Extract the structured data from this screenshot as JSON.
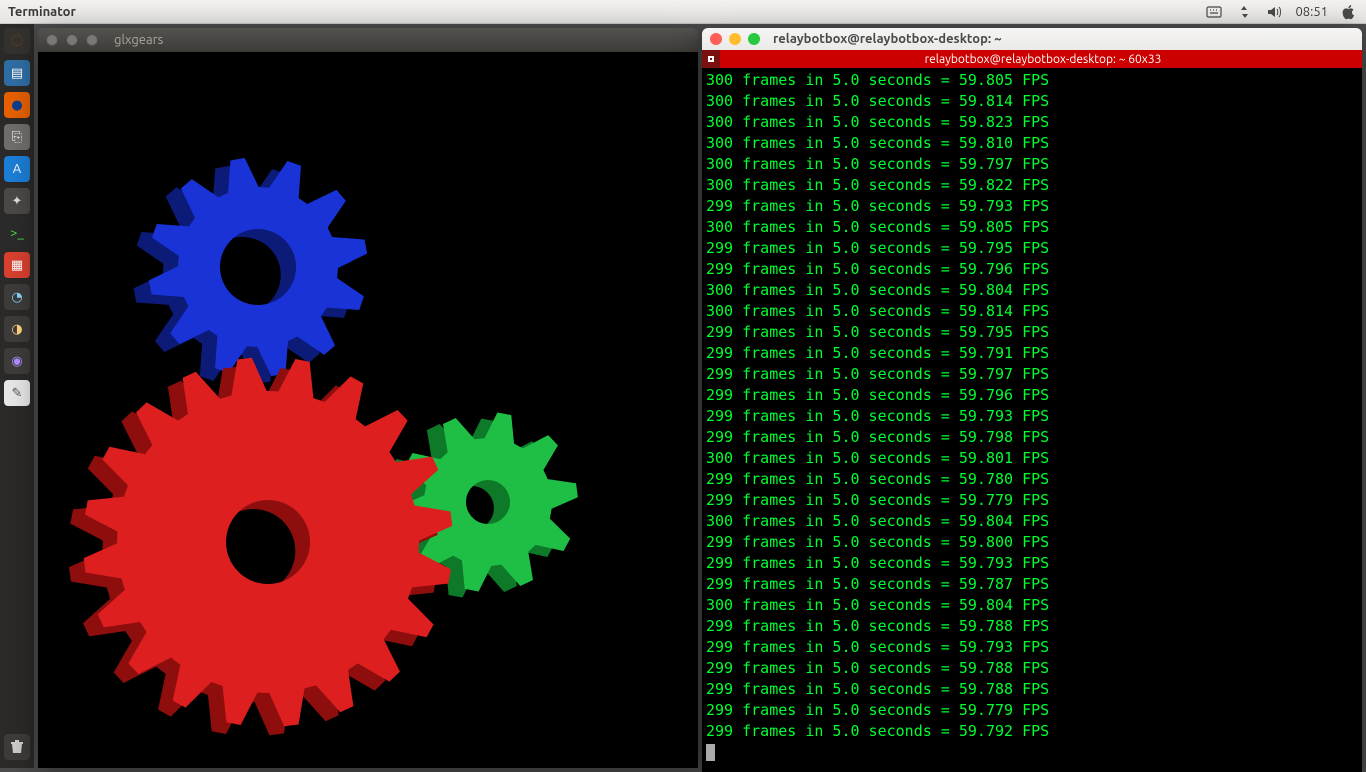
{
  "menubar": {
    "app_title": "Terminator",
    "clock": "08:51"
  },
  "launcher": {
    "items": [
      {
        "name": "dash",
        "bg": "#33322f",
        "glyph": "◌",
        "color": "#dd4814"
      },
      {
        "name": "files",
        "bg": "#2f6ea5",
        "glyph": "▤",
        "color": "#fff"
      },
      {
        "name": "firefox",
        "bg": "#e66000",
        "glyph": "●",
        "color": "#0b3e8c"
      },
      {
        "name": "software",
        "bg": "#6f6e6c",
        "glyph": "⎘",
        "color": "#fff"
      },
      {
        "name": "appstore",
        "bg": "#1c7ed6",
        "glyph": "A",
        "color": "#fff"
      },
      {
        "name": "settings",
        "bg": "#4a4947",
        "glyph": "✦",
        "color": "#ddd"
      },
      {
        "name": "terminal",
        "bg": "#2b2b2b",
        "glyph": ">_",
        "color": "#4ae24a"
      },
      {
        "name": "tile",
        "bg": "#d94030",
        "glyph": "▦",
        "color": "#fff"
      },
      {
        "name": "app1",
        "bg": "#3d3c3a",
        "glyph": "◔",
        "color": "#8fd3ff"
      },
      {
        "name": "app2",
        "bg": "#3d3c3a",
        "glyph": "◑",
        "color": "#ffd27f"
      },
      {
        "name": "app3",
        "bg": "#3d3c3a",
        "glyph": "◉",
        "color": "#b18cff"
      },
      {
        "name": "notes",
        "bg": "#e7e7e7",
        "glyph": "✎",
        "color": "#555"
      }
    ]
  },
  "glxgears": {
    "title": "glxgears"
  },
  "terminator": {
    "title": "relaybotbox@relaybotbox-desktop: ~",
    "status": "relaybotbox@relaybotbox-desktop: ~ 60x33",
    "lines": [
      {
        "frames": 300,
        "seconds": "5.0",
        "fps": "59.805"
      },
      {
        "frames": 300,
        "seconds": "5.0",
        "fps": "59.814"
      },
      {
        "frames": 300,
        "seconds": "5.0",
        "fps": "59.823"
      },
      {
        "frames": 300,
        "seconds": "5.0",
        "fps": "59.810"
      },
      {
        "frames": 300,
        "seconds": "5.0",
        "fps": "59.797"
      },
      {
        "frames": 300,
        "seconds": "5.0",
        "fps": "59.822"
      },
      {
        "frames": 299,
        "seconds": "5.0",
        "fps": "59.793"
      },
      {
        "frames": 300,
        "seconds": "5.0",
        "fps": "59.805"
      },
      {
        "frames": 299,
        "seconds": "5.0",
        "fps": "59.795"
      },
      {
        "frames": 299,
        "seconds": "5.0",
        "fps": "59.796"
      },
      {
        "frames": 300,
        "seconds": "5.0",
        "fps": "59.804"
      },
      {
        "frames": 300,
        "seconds": "5.0",
        "fps": "59.814"
      },
      {
        "frames": 299,
        "seconds": "5.0",
        "fps": "59.795"
      },
      {
        "frames": 299,
        "seconds": "5.0",
        "fps": "59.791"
      },
      {
        "frames": 299,
        "seconds": "5.0",
        "fps": "59.797"
      },
      {
        "frames": 299,
        "seconds": "5.0",
        "fps": "59.796"
      },
      {
        "frames": 299,
        "seconds": "5.0",
        "fps": "59.793"
      },
      {
        "frames": 299,
        "seconds": "5.0",
        "fps": "59.798"
      },
      {
        "frames": 300,
        "seconds": "5.0",
        "fps": "59.801"
      },
      {
        "frames": 299,
        "seconds": "5.0",
        "fps": "59.780"
      },
      {
        "frames": 299,
        "seconds": "5.0",
        "fps": "59.779"
      },
      {
        "frames": 300,
        "seconds": "5.0",
        "fps": "59.804"
      },
      {
        "frames": 299,
        "seconds": "5.0",
        "fps": "59.800"
      },
      {
        "frames": 299,
        "seconds": "5.0",
        "fps": "59.793"
      },
      {
        "frames": 299,
        "seconds": "5.0",
        "fps": "59.787"
      },
      {
        "frames": 300,
        "seconds": "5.0",
        "fps": "59.804"
      },
      {
        "frames": 299,
        "seconds": "5.0",
        "fps": "59.788"
      },
      {
        "frames": 299,
        "seconds": "5.0",
        "fps": "59.793"
      },
      {
        "frames": 299,
        "seconds": "5.0",
        "fps": "59.788"
      },
      {
        "frames": 299,
        "seconds": "5.0",
        "fps": "59.788"
      },
      {
        "frames": 299,
        "seconds": "5.0",
        "fps": "59.779"
      },
      {
        "frames": 299,
        "seconds": "5.0",
        "fps": "59.792"
      }
    ]
  },
  "colors": {
    "gear_red": "#dd1f1f",
    "gear_red_dark": "#8e0e0e",
    "gear_blue": "#1933d6",
    "gear_blue_dark": "#0c1a78",
    "gear_green": "#1fbf46",
    "gear_green_dark": "#0e7a29"
  }
}
